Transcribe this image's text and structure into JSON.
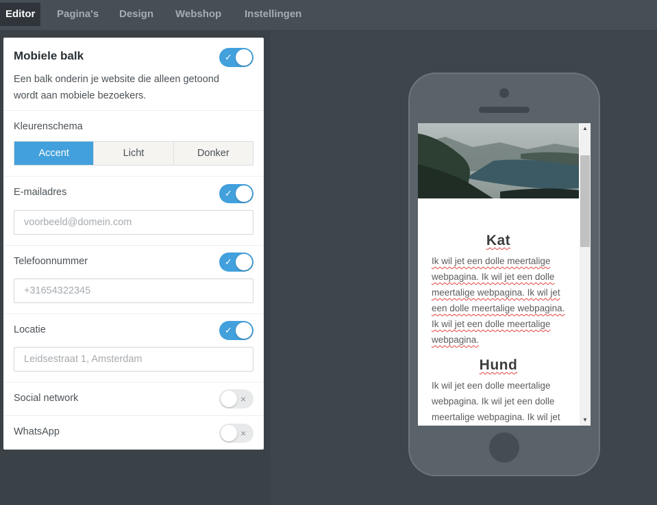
{
  "nav": {
    "tabs": [
      "Editor",
      "Pagina's",
      "Design",
      "Webshop",
      "Instellingen"
    ],
    "active": "Editor"
  },
  "panel": {
    "title": "Mobiele balk",
    "title_toggle": "on",
    "description": "Een balk onderin je website die alleen getoond wordt aan mobiele bezoekers.",
    "color_scheme": {
      "label": "Kleurenschema",
      "options": [
        "Accent",
        "Licht",
        "Donker"
      ],
      "selected": "Accent"
    },
    "email": {
      "label": "E-mailadres",
      "toggle": "on",
      "placeholder": "voorbeeld@domein.com",
      "value": ""
    },
    "phone": {
      "label": "Telefoonnummer",
      "toggle": "on",
      "placeholder": "+31654322345",
      "value": ""
    },
    "location": {
      "label": "Locatie",
      "toggle": "on",
      "placeholder": "Leidsestraat 1, Amsterdam",
      "value": ""
    },
    "social": {
      "label": "Social network",
      "toggle": "off"
    },
    "whatsapp": {
      "label": "WhatsApp",
      "toggle": "off"
    },
    "toggle_on_mark": "✓",
    "toggle_off_mark": "×"
  },
  "preview": {
    "sections": [
      {
        "heading": "Kat",
        "text": "Ik wil jet een dolle meertalige webpagina. Ik wil jet een dolle meertalige webpagina. Ik wil jet een dolle meertalige webpagina. Ik wil jet een dolle meertalige webpagina."
      },
      {
        "heading": "Hund",
        "text": "Ik wil jet een dolle meertalige webpagina. Ik wil jet een dolle meertalige webpagina. Ik wil jet"
      }
    ],
    "scroll_up": "▲",
    "scroll_down": "▼"
  },
  "colors": {
    "accent": "#42a0dc",
    "topbar": "#474f56",
    "background": "#3b4247",
    "phone": "#5a6369"
  },
  "icons": {
    "check": "check-icon",
    "cross": "close-icon"
  }
}
